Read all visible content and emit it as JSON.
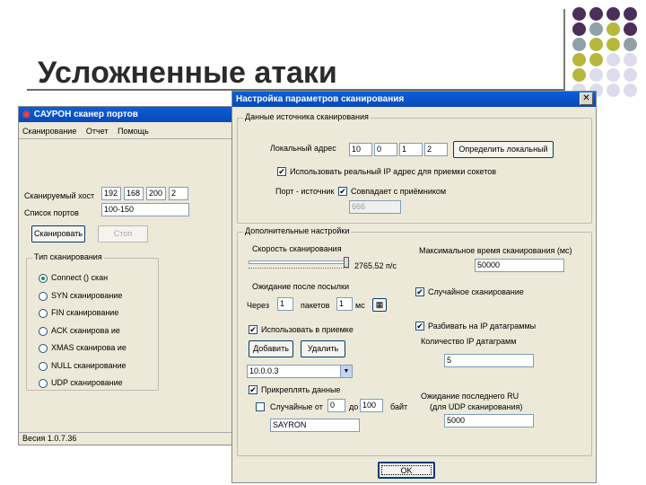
{
  "slide": {
    "title": "Усложненные атаки",
    "dot_colors": [
      "#4b2e5a",
      "#4b2e5a",
      "#4b2e5a",
      "#4b2e5a",
      "#4b2e5a",
      "#8fa0a6",
      "#b5b83a",
      "#4b2e5a",
      "#8fa0a6",
      "#b5b83a",
      "#b5b83a",
      "#8fa0a6",
      "#b5b83a",
      "#b5b83a",
      "#dcdcec",
      "#dcdcec",
      "#b5b83a",
      "#dcdcec",
      "#dcdcec",
      "#dcdcec",
      "#dcdcec",
      "#dcdcec",
      "#dcdcec",
      "#dcdcec"
    ]
  },
  "main_window": {
    "title": "САУРОН сканер портов",
    "menu": [
      "Сканирование",
      "Отчет",
      "Помощь"
    ],
    "scanned_host_label": "Сканируемый хост",
    "ip": [
      "192",
      "168",
      "200",
      "2"
    ],
    "port_list_label": "Список портов",
    "port_list_value": "100-150",
    "scan_button": "Сканировать",
    "stop_button": "Стоп",
    "scan_type_group": "Тип сканирования",
    "scan_types": [
      "Connect () скан",
      "SYN сканирование",
      "FIN сканирование",
      "ACK сканирова ие",
      "XMAS сканирова ие",
      "NULL сканирование",
      "UDP сканирование"
    ],
    "status": "Весия 1.0.7.36"
  },
  "dialog": {
    "title": "Настройка параметров сканирования",
    "close_label": "✕",
    "source_group": "Данные источника сканирования",
    "local_address_label": "Локальный адрес",
    "local_ip": [
      "10",
      "0",
      "1",
      "2"
    ],
    "detect_local_button": "Определить локальный",
    "use_real_ip": "Использовать реальный IP адрес для приемки сокетов",
    "source_port_label": "Порт - источник",
    "same_as_receiver": "Совпадает с приёмником",
    "source_port_value": "666",
    "extra_group": "Дополнительные настройки",
    "scan_speed_label": "Скорость сканирования",
    "speed_value": "2765.52 п/с",
    "speed_level": 0.97,
    "max_time_label": "Максимальное время сканирования (мс)",
    "max_time_value": "50000",
    "waiting_label": "Ожидание после посылки",
    "every_label": "Через",
    "packets_value": "1",
    "packets_label": "пакетов",
    "ms_value": "1",
    "ms_label": "мс",
    "random_scan": "Случайное сканирование",
    "use_in_receive": "Использовать в приемке",
    "add_button": "Добавить",
    "delete_button": "Удалить",
    "list_value": "10.0.0.3",
    "split_ip": "Разбивать на IP датаграммы",
    "ip_count_label": "Количество IP датаграмм",
    "ip_count_value": "5",
    "attach_data": "Прикреплять данные",
    "random_from_label": "Случайные от",
    "from_value": "0",
    "to_label": "до",
    "to_value": "100",
    "bytes_label": "байт",
    "data_value": "SAYRON",
    "wait_last_label": "Ожидание последнего RU",
    "udp_label": "(для UDP сканирования)",
    "wait_last_value": "5000",
    "ok_button": "OK"
  }
}
